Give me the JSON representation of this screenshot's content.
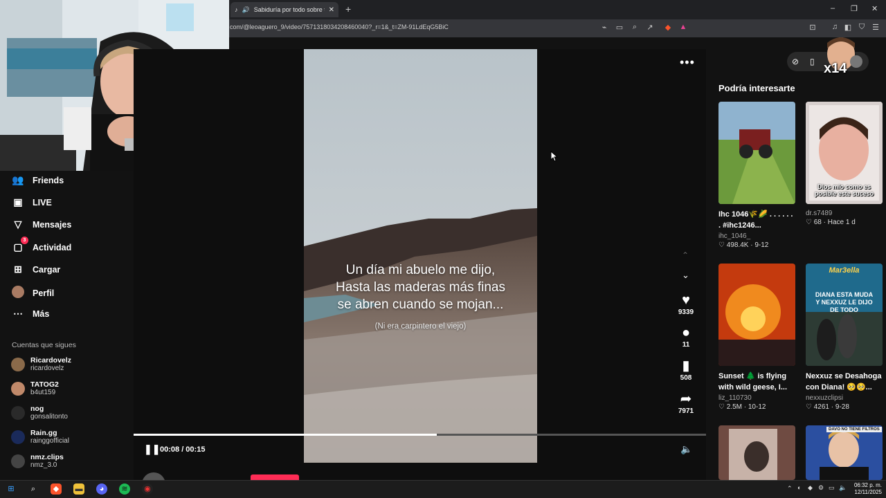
{
  "browser": {
    "tab_title": "Sabiduría por todo sobre todo",
    "new_tab": "+",
    "url": "com/@leoaguero_9/video/7571318034208460040?_r=1&_t=ZM-91LdEqG5BiC",
    "window_controls": {
      "minimize": "–",
      "maximize": "❐",
      "close": "✕"
    }
  },
  "sidebar": {
    "items": [
      {
        "label": "Friends",
        "icon": "friends-icon"
      },
      {
        "label": "LIVE",
        "icon": "live-icon"
      },
      {
        "label": "Mensajes",
        "icon": "messages-icon"
      },
      {
        "label": "Actividad",
        "icon": "activity-icon",
        "badge": "3"
      },
      {
        "label": "Cargar",
        "icon": "upload-icon"
      },
      {
        "label": "Perfil",
        "icon": "profile-avatar"
      },
      {
        "label": "Más",
        "icon": "more-dots-icon"
      }
    ],
    "following_title": "Cuentas que sigues",
    "following": [
      {
        "name": "Ricardovelz",
        "handle": "ricardovelz",
        "color": "#8a6a4a"
      },
      {
        "name": "TATOG2",
        "handle": "b4ut159",
        "color": "#c0896a"
      },
      {
        "name": "nog",
        "handle": "gonsalitonto",
        "color": "#2a2a2a"
      },
      {
        "name": "Rain.gg",
        "handle": "rainggofficial",
        "color": "#1a2a5a"
      },
      {
        "name": "nmz.clips",
        "handle": "nmz_3.0",
        "color": "#444444"
      }
    ]
  },
  "video": {
    "caption_lines": [
      "Un día mi abuelo me dijo,",
      "Hasta las maderas más finas",
      "se abren cuando se mojan..."
    ],
    "subcaption": "(Ni era carpintero el viejo)",
    "progress": 0.53,
    "time": "00:08 / 00:15",
    "author": "leoaguero_9",
    "actions": {
      "likes": "9339",
      "comments": "11",
      "saves": "508",
      "shares": "7971"
    }
  },
  "recommendations": {
    "title": "Podría interesarte",
    "overlay_badge": "x14",
    "cards": [
      {
        "title": "Ihc 1046🌾🌽 . . . . . . . #ihc1246...",
        "user": "ihc_1046_",
        "stats": "♡ 498.4K · 9-12"
      },
      {
        "title": "",
        "user": "dr.s7489",
        "stats": "♡ 68 · Hace 1 d",
        "overlay": "Dios mío como es posible este suceso"
      },
      {
        "title": "Sunset 🌲 is flying with wild geese, I...",
        "user": "liz_110730",
        "stats": "♡ 2.5M · 10-12"
      },
      {
        "title": "Nexxuz se Desahoga con Diana! 🥺🥺...",
        "user": "nexxuzclipsi",
        "stats": "♡ 4261 · 9-28",
        "overlay": "DIANA ESTA MUDA Y NEXXUZ LE DIJO DE TODO",
        "brand": "Mar3ella"
      },
      {
        "title": "",
        "user": "",
        "stats": ""
      },
      {
        "title": "",
        "user": "",
        "stats": "",
        "overlay": "DAVO NO TIENE FILTROS"
      }
    ]
  },
  "taskbar": {
    "time": "06:32 p. m.",
    "date": "12/11/2025"
  }
}
